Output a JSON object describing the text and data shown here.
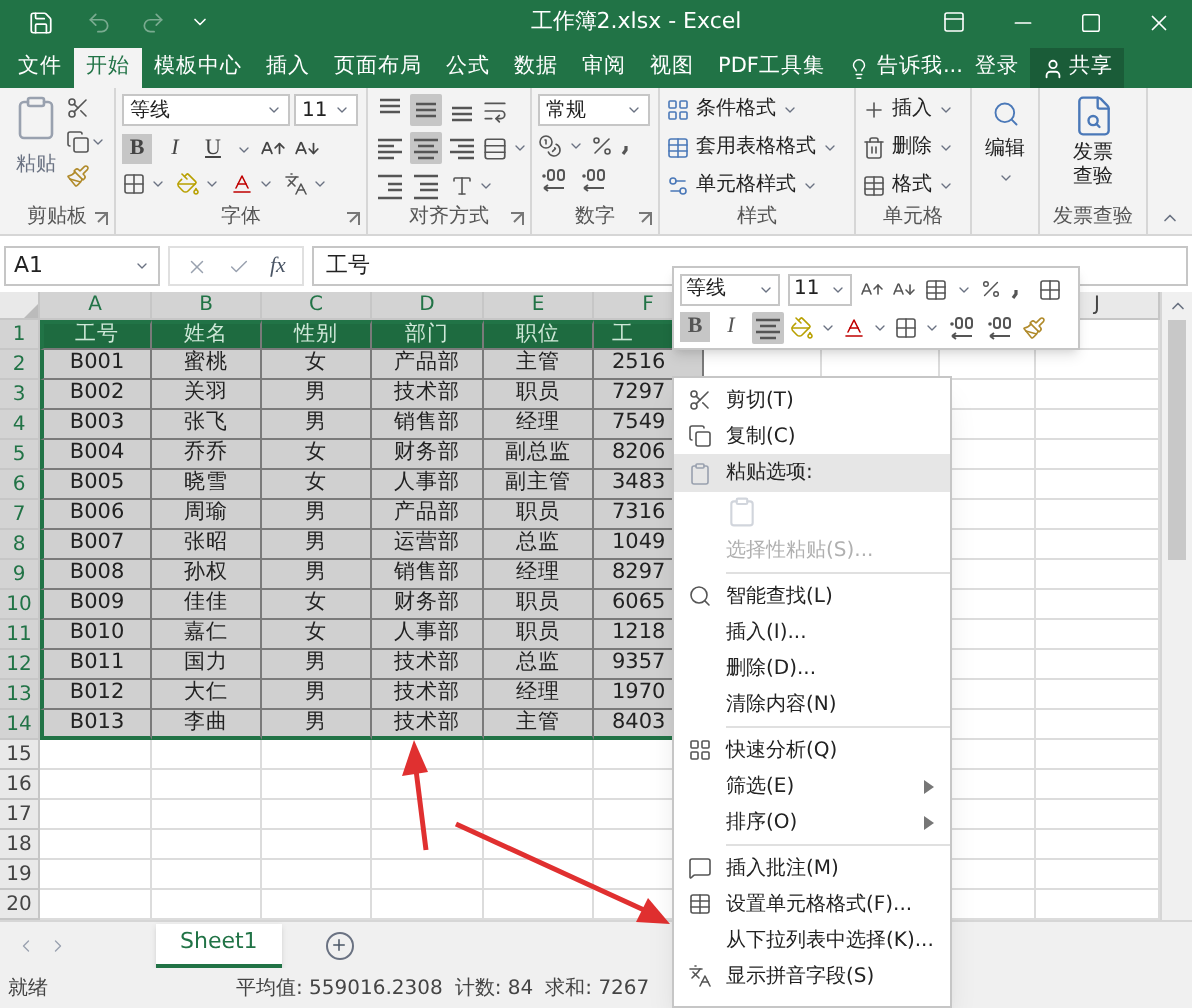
{
  "window": {
    "title": "工作簿2.xlsx - Excel"
  },
  "ribbon_tabs": [
    {
      "label": "文件",
      "selected": false
    },
    {
      "label": "开始",
      "selected": true
    },
    {
      "label": "模板中心",
      "selected": false
    },
    {
      "label": "插入",
      "selected": false
    },
    {
      "label": "页面布局",
      "selected": false
    },
    {
      "label": "公式",
      "selected": false
    },
    {
      "label": "数据",
      "selected": false
    },
    {
      "label": "审阅",
      "selected": false
    },
    {
      "label": "视图",
      "selected": false
    },
    {
      "label": "PDF工具集",
      "selected": false
    }
  ],
  "tell_me": "告诉我...",
  "sign_in": "登录",
  "share": "共享",
  "ribbon": {
    "clipboard": {
      "paste": "粘贴",
      "label": "剪贴板"
    },
    "font": {
      "name": "等线",
      "size": "11",
      "label": "字体",
      "buttons": [
        {
          "label": "B",
          "selected": true
        },
        {
          "label": "I",
          "selected": false
        },
        {
          "label": "U",
          "selected": false
        }
      ]
    },
    "alignment": {
      "label": "对齐方式",
      "vertical_middle": true,
      "horizontal_center": true
    },
    "number": {
      "format": "常规",
      "label": "数字"
    },
    "styles": {
      "items": [
        "条件格式",
        "套用表格格式",
        "单元格样式"
      ],
      "label": "样式"
    },
    "cells": {
      "items": [
        "插入",
        "删除",
        "格式"
      ],
      "label": "单元格"
    },
    "editing": {
      "button": "编辑"
    },
    "invoice": {
      "button_lines": [
        "发票",
        "查验"
      ],
      "label": "发票查验"
    }
  },
  "formula_bar": {
    "name_box": "A1",
    "function_label": "fx",
    "value": "工号"
  },
  "mini_toolbar": {
    "font": "等线",
    "size": "11",
    "buttons": [
      {
        "label": "B",
        "selected": true
      },
      {
        "label": "I",
        "selected": false
      }
    ],
    "center_selected": true
  },
  "column_headers": [
    {
      "label": "A",
      "selected": true
    },
    {
      "label": "B",
      "selected": true
    },
    {
      "label": "C",
      "selected": true
    },
    {
      "label": "D",
      "selected": true
    },
    {
      "label": "E",
      "selected": true
    },
    {
      "label": "F",
      "selected": true
    },
    {
      "label": "J",
      "selected": false
    }
  ],
  "rows": [
    {
      "number": "1",
      "kind": "header",
      "selected": true,
      "cells": [
        "工号",
        "姓名",
        "性别",
        "部门",
        "职位",
        "工"
      ]
    },
    {
      "number": "2",
      "kind": "data",
      "selected": true,
      "cells": [
        "B001",
        "蜜桃",
        "女",
        "产品部",
        "主管",
        "2516"
      ]
    },
    {
      "number": "3",
      "kind": "data",
      "selected": true,
      "cells": [
        "B002",
        "关羽",
        "男",
        "技术部",
        "职员",
        "7297"
      ]
    },
    {
      "number": "4",
      "kind": "data",
      "selected": true,
      "cells": [
        "B003",
        "张飞",
        "男",
        "销售部",
        "经理",
        "7549"
      ]
    },
    {
      "number": "5",
      "kind": "data",
      "selected": true,
      "cells": [
        "B004",
        "乔乔",
        "女",
        "财务部",
        "副总监",
        "8206"
      ]
    },
    {
      "number": "6",
      "kind": "data",
      "selected": true,
      "cells": [
        "B005",
        "晓雪",
        "女",
        "人事部",
        "副主管",
        "3483"
      ]
    },
    {
      "number": "7",
      "kind": "data",
      "selected": true,
      "cells": [
        "B006",
        "周瑜",
        "男",
        "产品部",
        "职员",
        "7316"
      ]
    },
    {
      "number": "8",
      "kind": "data",
      "selected": true,
      "cells": [
        "B007",
        "张昭",
        "男",
        "运营部",
        "总监",
        "1049"
      ]
    },
    {
      "number": "9",
      "kind": "data",
      "selected": true,
      "cells": [
        "B008",
        "孙权",
        "男",
        "销售部",
        "经理",
        "8297"
      ]
    },
    {
      "number": "10",
      "kind": "data",
      "selected": true,
      "cells": [
        "B009",
        "佳佳",
        "女",
        "财务部",
        "职员",
        "6065"
      ]
    },
    {
      "number": "11",
      "kind": "data",
      "selected": true,
      "cells": [
        "B010",
        "嘉仁",
        "女",
        "人事部",
        "职员",
        "1218"
      ]
    },
    {
      "number": "12",
      "kind": "data",
      "selected": true,
      "cells": [
        "B011",
        "国力",
        "男",
        "技术部",
        "总监",
        "9357"
      ]
    },
    {
      "number": "13",
      "kind": "data",
      "selected": true,
      "cells": [
        "B012",
        "大仁",
        "男",
        "技术部",
        "经理",
        "1970"
      ]
    },
    {
      "number": "14",
      "kind": "data",
      "selected": true,
      "cells": [
        "B013",
        "李曲",
        "男",
        "技术部",
        "主管",
        "8403"
      ]
    },
    {
      "number": "15",
      "kind": "empty",
      "selected": false
    },
    {
      "number": "16",
      "kind": "empty",
      "selected": false
    },
    {
      "number": "17",
      "kind": "empty",
      "selected": false
    },
    {
      "number": "18",
      "kind": "empty",
      "selected": false
    },
    {
      "number": "19",
      "kind": "empty",
      "selected": false
    },
    {
      "number": "20",
      "kind": "empty",
      "selected": false
    }
  ],
  "sheet_tabs": [
    {
      "label": "Sheet1",
      "selected": true
    }
  ],
  "status_bar": {
    "ready": "就绪",
    "average": "平均值: 559016.2308",
    "count": "计数: 84",
    "sum": "求和: 7267"
  },
  "context_menu": [
    {
      "kind": "item",
      "label": "剪切(T)",
      "disabled": false,
      "submenu": false
    },
    {
      "kind": "item",
      "label": "复制(C)",
      "disabled": false,
      "submenu": false
    },
    {
      "kind": "header",
      "label": "粘贴选项:"
    },
    {
      "kind": "paste-icons",
      "disabled": true
    },
    {
      "kind": "item",
      "label": "选择性粘贴(S)...",
      "disabled": true,
      "submenu": false
    },
    {
      "kind": "separator"
    },
    {
      "kind": "item",
      "label": "智能查找(L)",
      "disabled": false,
      "submenu": false
    },
    {
      "kind": "item",
      "label": "插入(I)...",
      "disabled": false,
      "submenu": false
    },
    {
      "kind": "item",
      "label": "删除(D)...",
      "disabled": false,
      "submenu": false
    },
    {
      "kind": "item",
      "label": "清除内容(N)",
      "disabled": false,
      "submenu": false
    },
    {
      "kind": "separator"
    },
    {
      "kind": "item",
      "label": "快速分析(Q)",
      "disabled": false,
      "submenu": false
    },
    {
      "kind": "item",
      "label": "筛选(E)",
      "disabled": false,
      "submenu": true
    },
    {
      "kind": "item",
      "label": "排序(O)",
      "disabled": false,
      "submenu": true
    },
    {
      "kind": "separator"
    },
    {
      "kind": "item",
      "label": "插入批注(M)",
      "disabled": false,
      "submenu": false
    },
    {
      "kind": "item",
      "label": "设置单元格格式(F)...",
      "disabled": false,
      "submenu": false
    },
    {
      "kind": "item",
      "label": "从下拉列表中选择(K)...",
      "disabled": false,
      "submenu": false
    },
    {
      "kind": "item",
      "label": "显示拼音字段(S)",
      "disabled": false,
      "submenu": false
    }
  ]
}
